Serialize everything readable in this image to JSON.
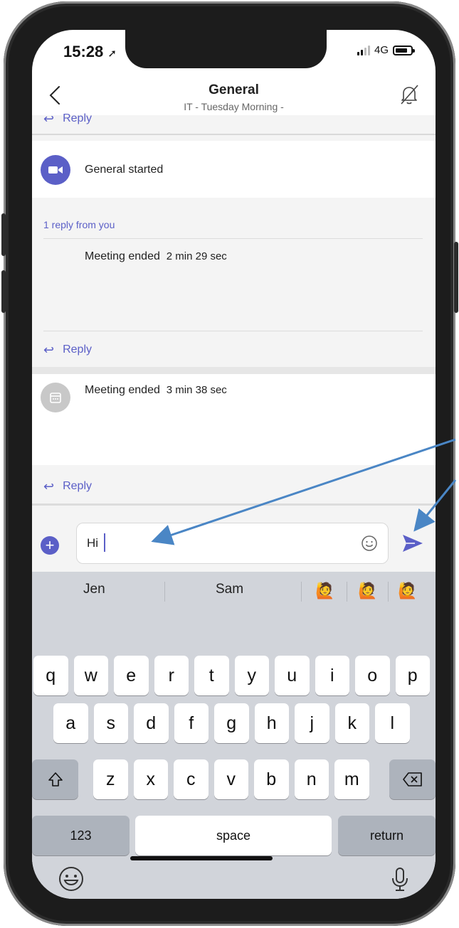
{
  "status": {
    "time": "15:28",
    "network": "4G"
  },
  "header": {
    "title": "General",
    "subtitle": "IT - Tuesday Morning -"
  },
  "feed": {
    "top_reply_label": "Reply",
    "meeting1": {
      "text": "General started",
      "thread_label": "1 reply from you",
      "reply_text": "Meeting ended",
      "reply_duration": "2 min 29 sec",
      "reply_label": "Reply"
    },
    "meeting2": {
      "text": "Meeting ended",
      "duration": "3 min 38 sec",
      "reply_label": "Reply"
    }
  },
  "compose": {
    "text": "Hi"
  },
  "keyboard": {
    "suggestions": [
      "Jen",
      "Sam"
    ],
    "row1": [
      "q",
      "w",
      "e",
      "r",
      "t",
      "y",
      "u",
      "i",
      "o",
      "p"
    ],
    "row2": [
      "a",
      "s",
      "d",
      "f",
      "g",
      "h",
      "j",
      "k",
      "l"
    ],
    "row3": [
      "z",
      "x",
      "c",
      "v",
      "b",
      "n",
      "m"
    ],
    "numbers_label": "123",
    "space_label": "space",
    "return_label": "return"
  },
  "colors": {
    "accent": "#5b5fc7",
    "annotation_arrow": "#4a86c5"
  }
}
